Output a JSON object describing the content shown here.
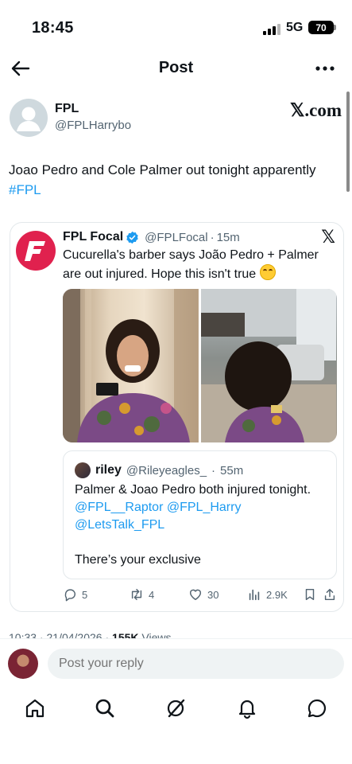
{
  "status_bar": {
    "time": "18:45",
    "network": "5G",
    "battery": "70"
  },
  "header": {
    "title": "Post"
  },
  "post": {
    "author_name": "FPL",
    "author_handle": "@FPLHarrybo",
    "watermark": "𝕏.com",
    "text": "Joao Pedro and Cole Palmer out tonight apparently ",
    "hashtag": "#FPL"
  },
  "quoted": {
    "name": "FPL Focal",
    "handle": "@FPLFocal",
    "separator": "·",
    "time": "15m",
    "x_logo": "𝕏",
    "text": "Cucurella's barber says João Pedro + Palmer are out injured. Hope this isn't true ",
    "emoji": "laughing-crying-emoji",
    "nested": {
      "name": "riley",
      "handle": "@Rileyeagles_",
      "separator": "·",
      "time": "55m",
      "text": "Palmer & Joao Pedro both injured tonight.",
      "mentions": [
        "@FPL__Raptor",
        "@FPL_Harry",
        "@LetsTalk_FPL"
      ],
      "closing": "There’s your exclusive"
    },
    "actions": {
      "replies": "5",
      "reposts": "4",
      "likes": "30",
      "views": "2.9K"
    }
  },
  "meta": {
    "time": "10:33",
    "date": "21/04/2026",
    "views_count": "155K",
    "views_label": "Views"
  },
  "reply": {
    "placeholder": "Post your reply"
  },
  "tabbar": {
    "items": [
      "home-icon",
      "search-icon",
      "grok-icon",
      "notifications-icon",
      "messages-icon"
    ]
  },
  "colors": {
    "accent": "#1d9bf0",
    "brand_red": "#e0214e",
    "text": "#0f1419",
    "muted": "#536471"
  }
}
